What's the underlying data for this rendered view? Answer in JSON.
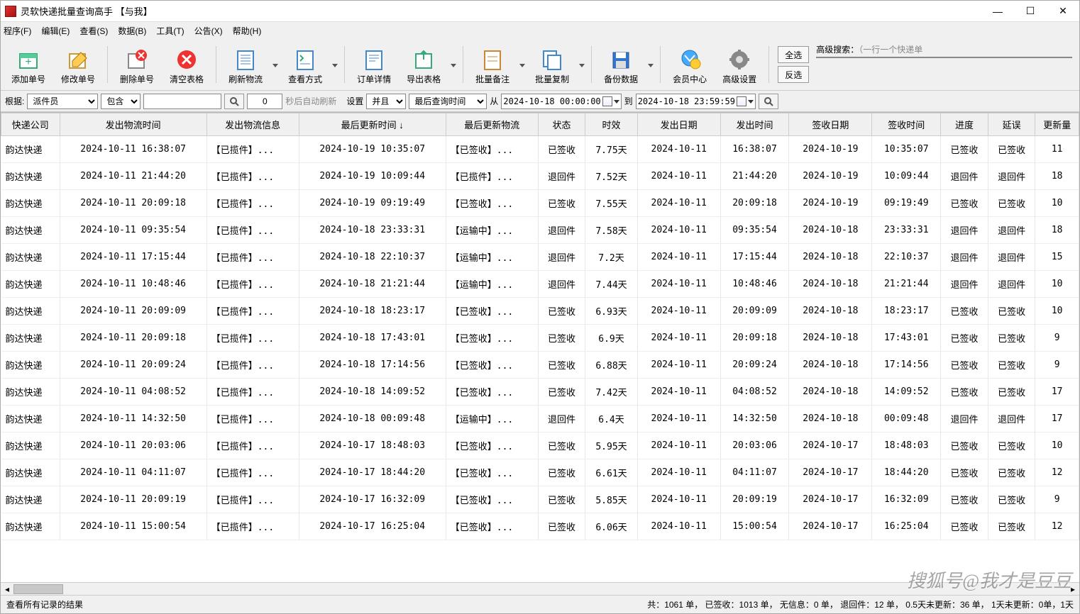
{
  "title": "灵软快递批量查询高手 【与我】",
  "menu": {
    "program": "程序(F)",
    "edit": "编辑(E)",
    "view": "查看(S)",
    "data": "数据(B)",
    "tools": "工具(T)",
    "notice": "公告(X)",
    "help": "帮助(H)"
  },
  "toolbar": {
    "add": "添加单号",
    "modify": "修改单号",
    "delete": "删除单号",
    "clear": "清空表格",
    "refresh": "刷新物流",
    "viewmode": "查看方式",
    "detail": "订单详情",
    "export": "导出表格",
    "batchnote": "批量备注",
    "batchcopy": "批量复制",
    "backup": "备份数据",
    "vip": "会员中心",
    "settings": "高级设置",
    "selall": "全选",
    "invsel": "反选"
  },
  "search": {
    "label": "高级搜索：",
    "placeholder": "（一行一个快递单"
  },
  "filter": {
    "basis_label": "根据:",
    "field": "派件员",
    "op": "包含",
    "value": "",
    "count": "0",
    "auto_refresh": "秒后自动刷新",
    "settings": "设置",
    "logic": "并且",
    "timefield": "最后查询时间",
    "from": "从",
    "from_val": "2024-10-18 00:00:00",
    "to": "到",
    "to_val": "2024-10-18 23:59:59"
  },
  "columns": [
    "快递公司",
    "发出物流时间",
    "发出物流信息",
    "最后更新时间 ↓",
    "最后更新物流",
    "状态",
    "时效",
    "发出日期",
    "发出时间",
    "签收日期",
    "签收时间",
    "进度",
    "延误",
    "更新量"
  ],
  "rows": [
    {
      "co": "韵达快递",
      "sent_t": "2024-10-11 16:38:07",
      "sent_i": "【已揽件】...",
      "upd_t": "2024-10-19 10:35:07",
      "upd_i": "【已签收】...",
      "st": "已签收",
      "age": "7.75天",
      "sd": "2024-10-11",
      "stm": "16:38:07",
      "rd": "2024-10-19",
      "rtm": "10:35:07",
      "prog": "已签收",
      "delay": "已签收",
      "cnt": "11"
    },
    {
      "co": "韵达快递",
      "sent_t": "2024-10-11 21:44:20",
      "sent_i": "【已揽件】...",
      "upd_t": "2024-10-19 10:09:44",
      "upd_i": "【已揽件】...",
      "st": "退回件",
      "age": "7.52天",
      "sd": "2024-10-11",
      "stm": "21:44:20",
      "rd": "2024-10-19",
      "rtm": "10:09:44",
      "prog": "退回件",
      "delay": "退回件",
      "cnt": "18"
    },
    {
      "co": "韵达快递",
      "sent_t": "2024-10-11 20:09:18",
      "sent_i": "【已揽件】...",
      "upd_t": "2024-10-19 09:19:49",
      "upd_i": "【已签收】...",
      "st": "已签收",
      "age": "7.55天",
      "sd": "2024-10-11",
      "stm": "20:09:18",
      "rd": "2024-10-19",
      "rtm": "09:19:49",
      "prog": "已签收",
      "delay": "已签收",
      "cnt": "10"
    },
    {
      "co": "韵达快递",
      "sent_t": "2024-10-11 09:35:54",
      "sent_i": "【已揽件】...",
      "upd_t": "2024-10-18 23:33:31",
      "upd_i": "【运输中】...",
      "st": "退回件",
      "age": "7.58天",
      "sd": "2024-10-11",
      "stm": "09:35:54",
      "rd": "2024-10-18",
      "rtm": "23:33:31",
      "prog": "退回件",
      "delay": "退回件",
      "cnt": "18"
    },
    {
      "co": "韵达快递",
      "sent_t": "2024-10-11 17:15:44",
      "sent_i": "【已揽件】...",
      "upd_t": "2024-10-18 22:10:37",
      "upd_i": "【运输中】...",
      "st": "退回件",
      "age": "7.2天",
      "sd": "2024-10-11",
      "stm": "17:15:44",
      "rd": "2024-10-18",
      "rtm": "22:10:37",
      "prog": "退回件",
      "delay": "退回件",
      "cnt": "15"
    },
    {
      "co": "韵达快递",
      "sent_t": "2024-10-11 10:48:46",
      "sent_i": "【已揽件】...",
      "upd_t": "2024-10-18 21:21:44",
      "upd_i": "【运输中】...",
      "st": "退回件",
      "age": "7.44天",
      "sd": "2024-10-11",
      "stm": "10:48:46",
      "rd": "2024-10-18",
      "rtm": "21:21:44",
      "prog": "退回件",
      "delay": "退回件",
      "cnt": "10"
    },
    {
      "co": "韵达快递",
      "sent_t": "2024-10-11 20:09:09",
      "sent_i": "【已揽件】...",
      "upd_t": "2024-10-18 18:23:17",
      "upd_i": "【已签收】...",
      "st": "已签收",
      "age": "6.93天",
      "sd": "2024-10-11",
      "stm": "20:09:09",
      "rd": "2024-10-18",
      "rtm": "18:23:17",
      "prog": "已签收",
      "delay": "已签收",
      "cnt": "10"
    },
    {
      "co": "韵达快递",
      "sent_t": "2024-10-11 20:09:18",
      "sent_i": "【已揽件】...",
      "upd_t": "2024-10-18 17:43:01",
      "upd_i": "【已签收】...",
      "st": "已签收",
      "age": "6.9天",
      "sd": "2024-10-11",
      "stm": "20:09:18",
      "rd": "2024-10-18",
      "rtm": "17:43:01",
      "prog": "已签收",
      "delay": "已签收",
      "cnt": "9"
    },
    {
      "co": "韵达快递",
      "sent_t": "2024-10-11 20:09:24",
      "sent_i": "【已揽件】...",
      "upd_t": "2024-10-18 17:14:56",
      "upd_i": "【已签收】...",
      "st": "已签收",
      "age": "6.88天",
      "sd": "2024-10-11",
      "stm": "20:09:24",
      "rd": "2024-10-18",
      "rtm": "17:14:56",
      "prog": "已签收",
      "delay": "已签收",
      "cnt": "9"
    },
    {
      "co": "韵达快递",
      "sent_t": "2024-10-11 04:08:52",
      "sent_i": "【已揽件】...",
      "upd_t": "2024-10-18 14:09:52",
      "upd_i": "【已签收】...",
      "st": "已签收",
      "age": "7.42天",
      "sd": "2024-10-11",
      "stm": "04:08:52",
      "rd": "2024-10-18",
      "rtm": "14:09:52",
      "prog": "已签收",
      "delay": "已签收",
      "cnt": "17"
    },
    {
      "co": "韵达快递",
      "sent_t": "2024-10-11 14:32:50",
      "sent_i": "【已揽件】...",
      "upd_t": "2024-10-18 00:09:48",
      "upd_i": "【运输中】...",
      "st": "退回件",
      "age": "6.4天",
      "sd": "2024-10-11",
      "stm": "14:32:50",
      "rd": "2024-10-18",
      "rtm": "00:09:48",
      "prog": "退回件",
      "delay": "退回件",
      "cnt": "17"
    },
    {
      "co": "韵达快递",
      "sent_t": "2024-10-11 20:03:06",
      "sent_i": "【已揽件】...",
      "upd_t": "2024-10-17 18:48:03",
      "upd_i": "【已签收】...",
      "st": "已签收",
      "age": "5.95天",
      "sd": "2024-10-11",
      "stm": "20:03:06",
      "rd": "2024-10-17",
      "rtm": "18:48:03",
      "prog": "已签收",
      "delay": "已签收",
      "cnt": "10"
    },
    {
      "co": "韵达快递",
      "sent_t": "2024-10-11 04:11:07",
      "sent_i": "【已揽件】...",
      "upd_t": "2024-10-17 18:44:20",
      "upd_i": "【已签收】...",
      "st": "已签收",
      "age": "6.61天",
      "sd": "2024-10-11",
      "stm": "04:11:07",
      "rd": "2024-10-17",
      "rtm": "18:44:20",
      "prog": "已签收",
      "delay": "已签收",
      "cnt": "12"
    },
    {
      "co": "韵达快递",
      "sent_t": "2024-10-11 20:09:19",
      "sent_i": "【已揽件】...",
      "upd_t": "2024-10-17 16:32:09",
      "upd_i": "【已签收】...",
      "st": "已签收",
      "age": "5.85天",
      "sd": "2024-10-11",
      "stm": "20:09:19",
      "rd": "2024-10-17",
      "rtm": "16:32:09",
      "prog": "已签收",
      "delay": "已签收",
      "cnt": "9"
    },
    {
      "co": "韵达快递",
      "sent_t": "2024-10-11 15:00:54",
      "sent_i": "【已揽件】...",
      "upd_t": "2024-10-17 16:25:04",
      "upd_i": "【已签收】...",
      "st": "已签收",
      "age": "6.06天",
      "sd": "2024-10-11",
      "stm": "15:00:54",
      "rd": "2024-10-17",
      "rtm": "16:25:04",
      "prog": "已签收",
      "delay": "已签收",
      "cnt": "12"
    }
  ],
  "status": {
    "left": "查看所有记录的结果",
    "right": "共：1061 单，  已签收：1013 单，  无信息：0 单，  退回件：12 单，  0.5天未更新：36 单，  1天未更新：0单，1天"
  },
  "watermark": "搜狐号@我才是豆豆"
}
